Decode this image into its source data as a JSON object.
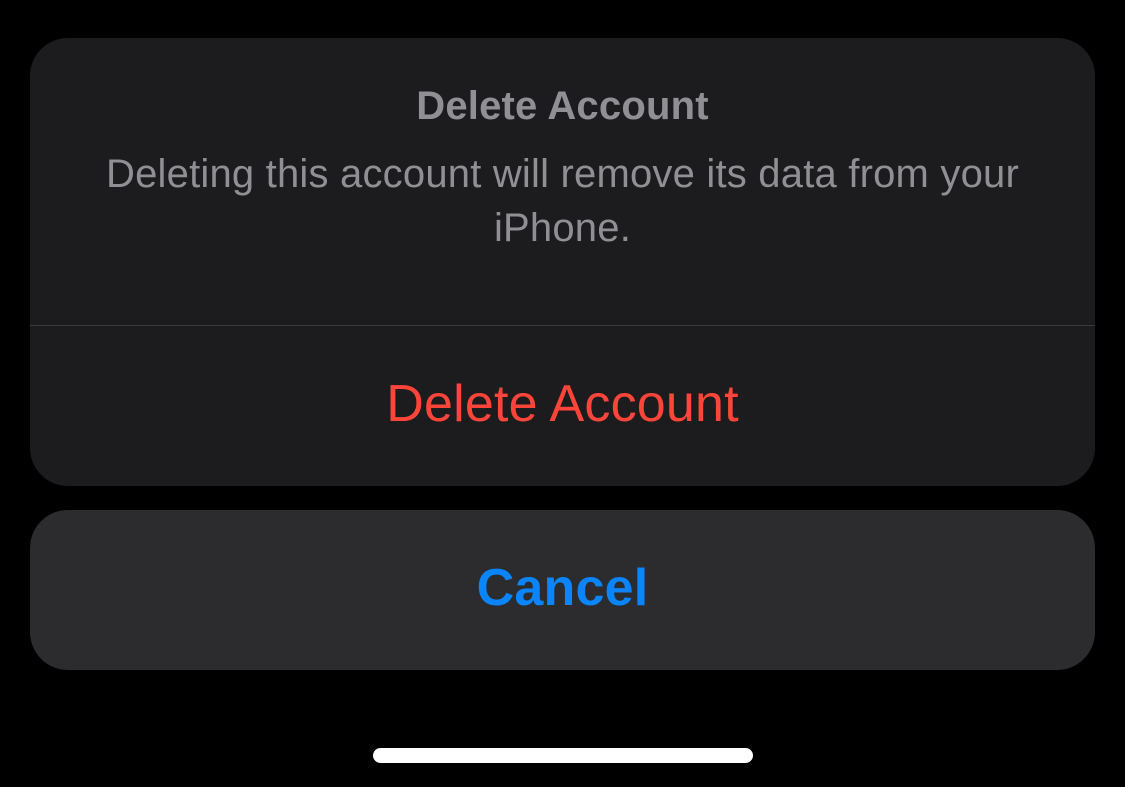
{
  "actionSheet": {
    "title": "Delete Account",
    "message": "Deleting this account will remove its data from your iPhone.",
    "destructiveAction": "Delete Account",
    "cancelAction": "Cancel"
  }
}
